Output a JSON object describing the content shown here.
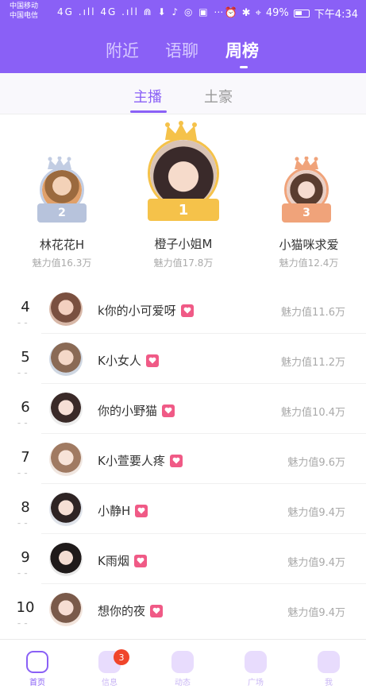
{
  "status_bar": {
    "carrier_line1": "中国移动",
    "carrier_line2": "中国电信",
    "signal_icons": "4G .ıll 4G .ıll ⋒ ⬇ ♪ ◎ ▣ ⋯",
    "battery": "49%",
    "time": "下午4:34"
  },
  "header": {
    "tabs": [
      {
        "label": "附近",
        "active": false
      },
      {
        "label": "语聊",
        "active": false
      },
      {
        "label": "周榜",
        "active": true
      }
    ]
  },
  "sub_tabs": [
    {
      "label": "主播",
      "active": true
    },
    {
      "label": "土豪",
      "active": false
    }
  ],
  "podium": [
    {
      "rank": "2",
      "name": "林花花H",
      "score": "魅力值16.3万"
    },
    {
      "rank": "1",
      "name": "橙子小姐M",
      "score": "魅力值17.8万"
    },
    {
      "rank": "3",
      "name": "小猫咪求爱",
      "score": "魅力值12.4万"
    }
  ],
  "list": [
    {
      "rank": "4",
      "name": "k你的小可爱呀",
      "score": "魅力值11.6万"
    },
    {
      "rank": "5",
      "name": "K小女人",
      "score": "魅力值11.2万"
    },
    {
      "rank": "6",
      "name": "你的小野猫",
      "score": "魅力值10.4万"
    },
    {
      "rank": "7",
      "name": "K小萱要人疼",
      "score": "魅力值9.6万"
    },
    {
      "rank": "8",
      "name": "小静H",
      "score": "魅力值9.4万"
    },
    {
      "rank": "9",
      "name": "K雨烟",
      "score": "魅力值9.4万"
    },
    {
      "rank": "10",
      "name": "想你的夜",
      "score": "魅力值9.4万"
    }
  ],
  "bottom_nav": {
    "items": [
      {
        "label": "首页",
        "icon": "home-icon",
        "active": true
      },
      {
        "label": "信息",
        "icon": "message-icon",
        "active": false
      },
      {
        "label": "动态",
        "icon": "moments-icon",
        "active": false
      },
      {
        "label": "广场",
        "icon": "square-icon",
        "active": false
      },
      {
        "label": "我",
        "icon": "profile-icon",
        "active": false
      }
    ],
    "message_badge": "3"
  },
  "colors": {
    "accent": "#8a60f6",
    "gold": "#f5c24a",
    "silver": "#b7c3dc",
    "bronze": "#f0a37a",
    "heart": "#f05a86"
  }
}
